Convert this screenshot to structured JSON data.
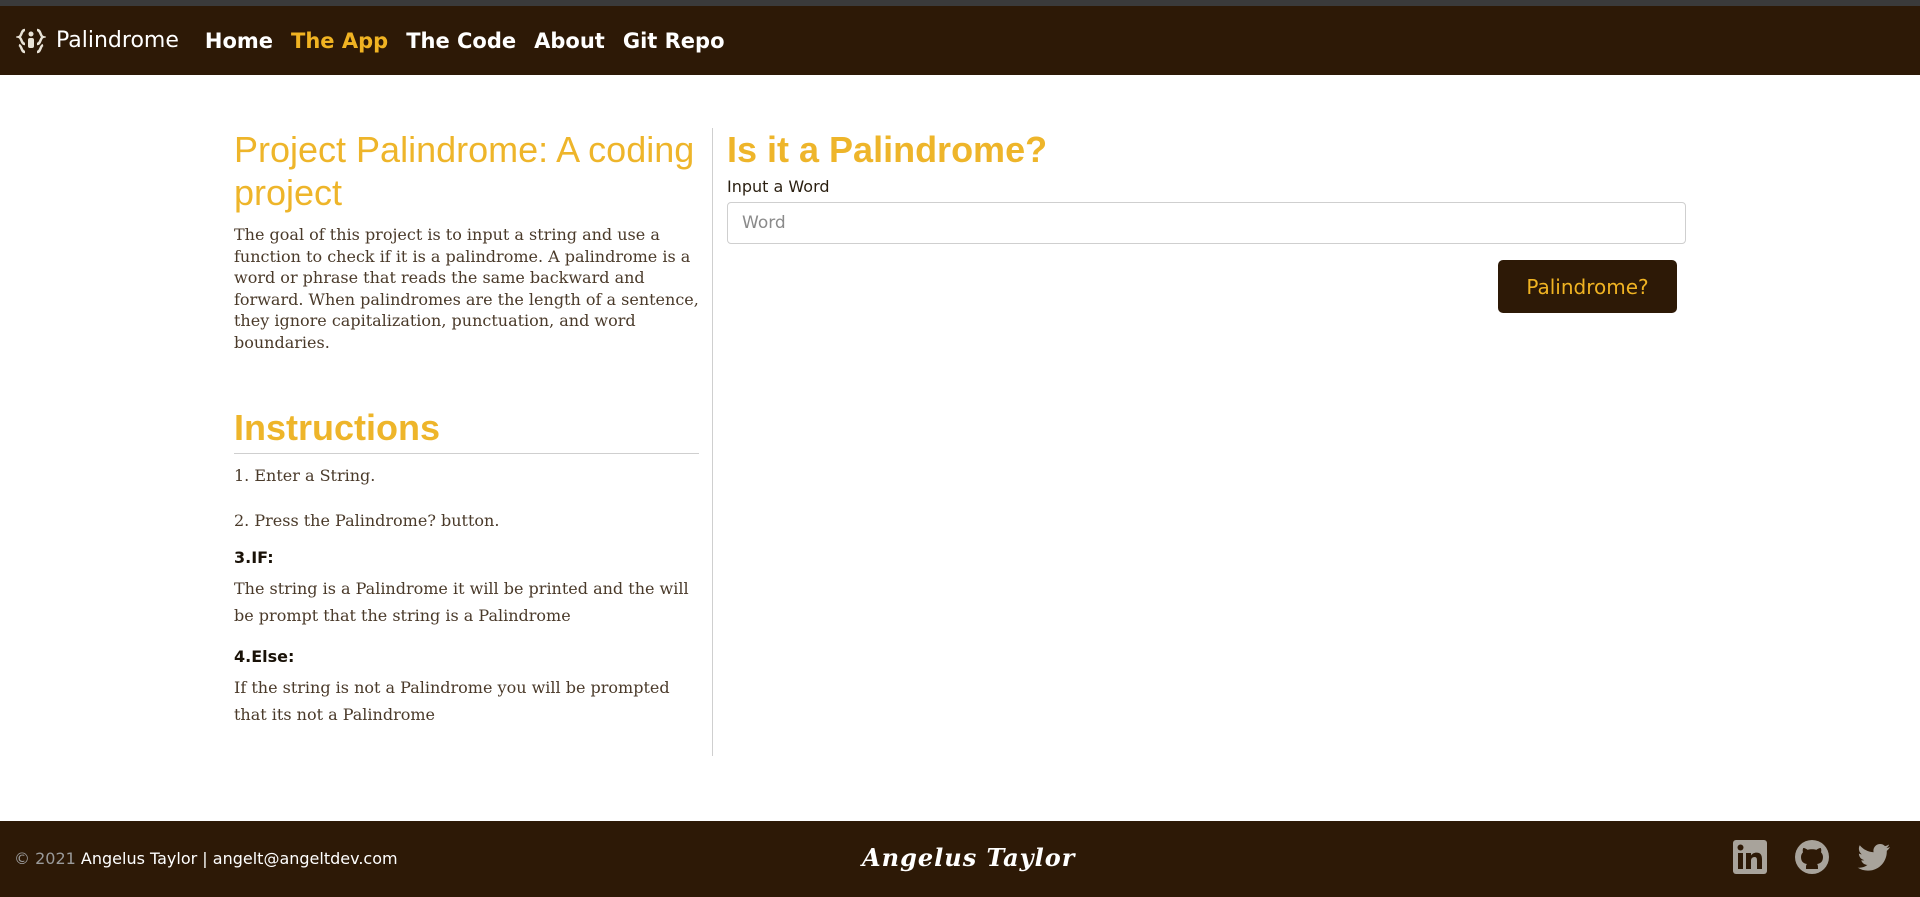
{
  "nav": {
    "brand": "Palindrome",
    "links": [
      {
        "label": "Home",
        "active": false
      },
      {
        "label": "The App",
        "active": true
      },
      {
        "label": "The Code",
        "active": false
      },
      {
        "label": "About",
        "active": false
      },
      {
        "label": "Git Repo",
        "active": false
      }
    ]
  },
  "left": {
    "title": "Project Palindrome: A coding project",
    "description": "The goal of this project is to input a string and use a function to check if it is a palindrome. A palindrome is a word or phrase that reads the same backward and forward. When palindromes are the length of a sentence, they ignore capitalization, punctuation, and word boundaries.",
    "instructions_title": "Instructions",
    "step1": "1. Enter a String.",
    "step2": "2. Press the Palindrome? button.",
    "step3_label": "3.IF:",
    "step3_text": "The string is a Palindrome it will be printed and the will be prompt that the string is a Palindrome",
    "step4_label": "4.Else:",
    "step4_text": "If the string is not a Palindrome you will be prompted that its not a Palindrome"
  },
  "app": {
    "title": "Is it a Palindrome?",
    "input_label": "Input a Word",
    "input_placeholder": "Word",
    "input_value": "",
    "button_label": "Palindrome?"
  },
  "footer": {
    "year": "© 2021",
    "name": "Angelus Taylor | angelt@angeltdev.com",
    "signature": "Angelus Taylor",
    "socials": [
      "linkedin-icon",
      "github-icon",
      "twitter-icon"
    ]
  },
  "colors": {
    "nav_bg": "#2d1906",
    "accent": "#eeb52a",
    "footer_icon": "#a8a39b"
  }
}
